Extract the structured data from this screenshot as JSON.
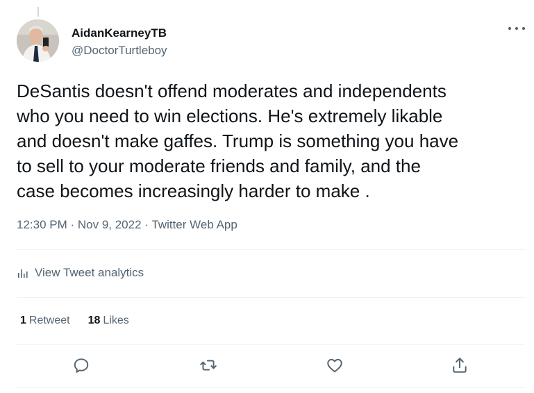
{
  "author": {
    "name": "AidanKearneyTB",
    "handle": "@DoctorTurtleboy"
  },
  "tweet": {
    "text": "DeSantis doesn't offend moderates and independents\nwho you need to win elections. He's extremely likable\nand doesn't make gaffes. Trump is something you have\nto sell to your moderate friends and family, and the\ncase becomes increasingly harder to make .",
    "time": "12:30 PM",
    "date": "Nov 9, 2022",
    "source": "Twitter Web App",
    "meta_line": "12:30 PM · Nov 9, 2022 · Twitter Web App"
  },
  "analytics": {
    "label": "View Tweet analytics",
    "icon": "bar-chart-icon"
  },
  "stats": {
    "retweets_count": "1",
    "retweets_label": "Retweet",
    "likes_count": "18",
    "likes_label": "Likes"
  },
  "actions": [
    {
      "icon": "reply-icon"
    },
    {
      "icon": "retweet-icon"
    },
    {
      "icon": "like-icon"
    },
    {
      "icon": "share-icon"
    }
  ],
  "colors": {
    "text_primary": "#0f1419",
    "text_secondary": "#536471",
    "divider": "#eff3f4"
  }
}
